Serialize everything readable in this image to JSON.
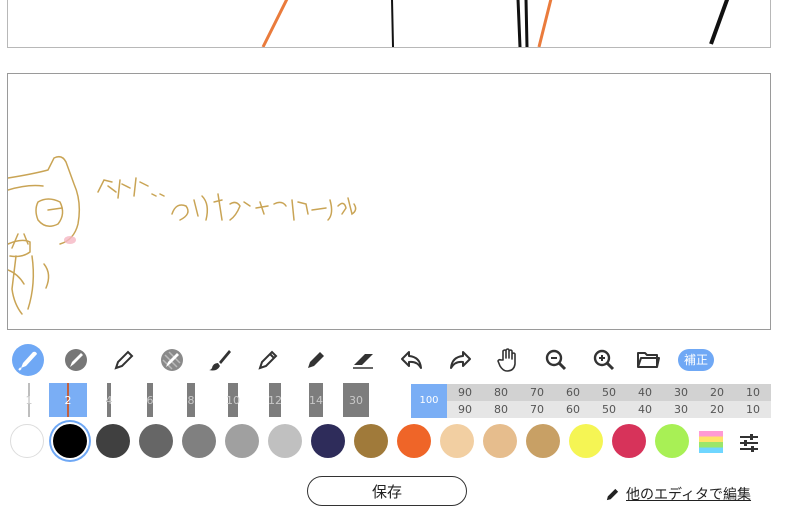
{
  "tools": [
    {
      "name": "pen-tool",
      "active": true
    },
    {
      "name": "blur-pen-tool",
      "active": false
    },
    {
      "name": "pencil-outline-tool",
      "active": false
    },
    {
      "name": "pattern-pen-tool",
      "active": false
    },
    {
      "name": "brush-tool",
      "active": false
    },
    {
      "name": "pencil-tool",
      "active": false
    },
    {
      "name": "marker-tool",
      "active": false
    },
    {
      "name": "eraser-tool",
      "active": false
    },
    {
      "name": "undo-button",
      "active": false
    },
    {
      "name": "redo-button",
      "active": false
    },
    {
      "name": "hand-tool",
      "active": false
    },
    {
      "name": "zoom-out-button",
      "active": false
    },
    {
      "name": "zoom-in-button",
      "active": false
    },
    {
      "name": "open-folder-button",
      "active": false
    }
  ],
  "correction_label": "補正",
  "pen_sizes": [
    {
      "label": "1",
      "selected": false
    },
    {
      "label": "2",
      "selected": true
    },
    {
      "label": "4",
      "selected": false
    },
    {
      "label": "6",
      "selected": false
    },
    {
      "label": "8",
      "selected": false
    },
    {
      "label": "10",
      "selected": false
    },
    {
      "label": "12",
      "selected": false
    },
    {
      "label": "14",
      "selected": false
    },
    {
      "label": "30",
      "selected": false
    }
  ],
  "opacity": {
    "selected": "100",
    "full_label": "100",
    "row1": [
      "90",
      "80",
      "70",
      "60",
      "50",
      "40",
      "30",
      "20",
      "10"
    ],
    "row2": [
      "90",
      "80",
      "70",
      "60",
      "50",
      "40",
      "30",
      "20",
      "10"
    ]
  },
  "colors": [
    {
      "name": "white",
      "hex": "#ffffff",
      "selected": false
    },
    {
      "name": "black",
      "hex": "#000000",
      "selected": true
    },
    {
      "name": "dark-gray",
      "hex": "#404040",
      "selected": false
    },
    {
      "name": "gray-1",
      "hex": "#666666",
      "selected": false
    },
    {
      "name": "gray-2",
      "hex": "#808080",
      "selected": false
    },
    {
      "name": "gray-3",
      "hex": "#a0a0a0",
      "selected": false
    },
    {
      "name": "light-gray",
      "hex": "#c0c0c0",
      "selected": false
    },
    {
      "name": "navy",
      "hex": "#2e2c5a",
      "selected": false
    },
    {
      "name": "brown",
      "hex": "#a07a3a",
      "selected": false
    },
    {
      "name": "orange",
      "hex": "#ef6528",
      "selected": false
    },
    {
      "name": "skin-light",
      "hex": "#f2cfa2",
      "selected": false
    },
    {
      "name": "skin",
      "hex": "#e6bd8d",
      "selected": false
    },
    {
      "name": "tan",
      "hex": "#c8a065",
      "selected": false
    },
    {
      "name": "yellow",
      "hex": "#f5f554",
      "selected": false
    },
    {
      "name": "crimson",
      "hex": "#d7335a",
      "selected": false
    },
    {
      "name": "lime",
      "hex": "#a8f055",
      "selected": false
    }
  ],
  "canvas_text": "ドキドキ‥ ありがたごまーしゅ♪",
  "save_label": "保存",
  "other_editor_label": "他のエディタで編集"
}
